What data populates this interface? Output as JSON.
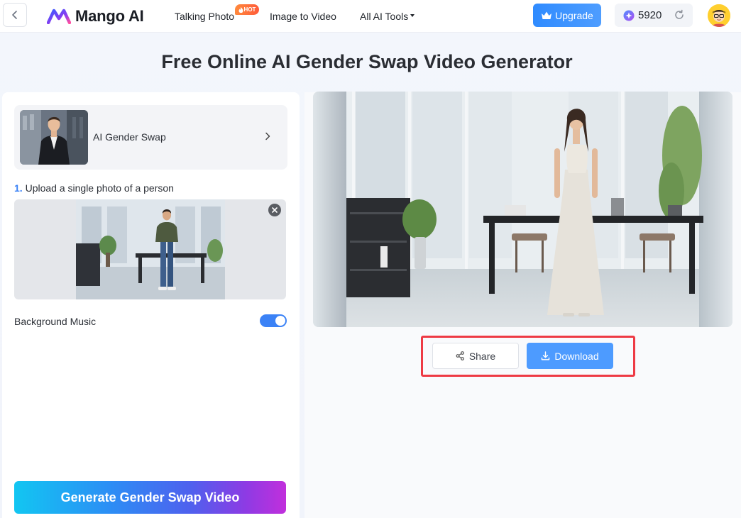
{
  "header": {
    "brand": "Mango AI",
    "nav": [
      {
        "label": "Talking Photo",
        "badge": "HOT"
      },
      {
        "label": "Image to Video"
      },
      {
        "label": "All AI Tools"
      }
    ],
    "upgrade_label": "Upgrade",
    "credits": "5920",
    "icons": [
      "back-arrow-icon",
      "mango-logo-icon",
      "flame-icon",
      "caret-down-icon",
      "crown-icon",
      "credit-gem-icon",
      "refresh-icon",
      "avatar"
    ]
  },
  "page": {
    "title": "Free Online AI Gender Swap Video Generator"
  },
  "left": {
    "tool_name": "AI Gender Swap",
    "step_number": "1.",
    "step_text": "Upload a single photo of a person",
    "bgm_label": "Background Music",
    "bgm_enabled": true,
    "generate_label": "Generate Gender Swap Video"
  },
  "right": {
    "share_label": "Share",
    "download_label": "Download"
  },
  "colors": {
    "accent": "#3b82f6",
    "highlight": "#ee3a44",
    "generate_gradient_start": "#12c6f2",
    "generate_gradient_end": "#c12fdc"
  }
}
